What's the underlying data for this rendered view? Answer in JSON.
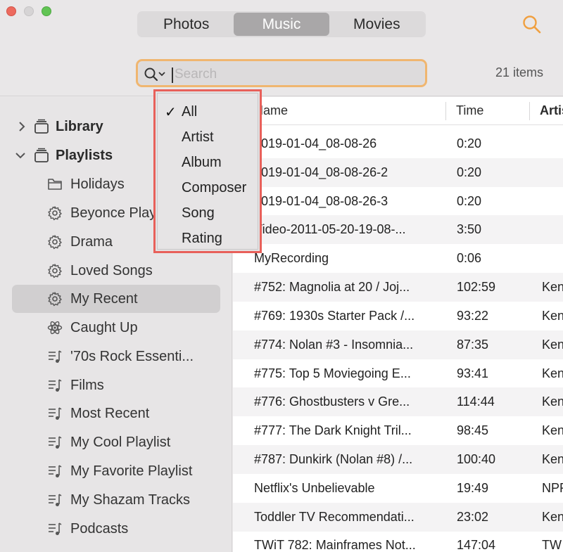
{
  "toolbar": {
    "tabs": [
      {
        "label": "Photos",
        "active": false
      },
      {
        "label": "Music",
        "active": true
      },
      {
        "label": "Movies",
        "active": false
      }
    ],
    "search": {
      "placeholder": "Search",
      "value": ""
    },
    "items_count": "21 items",
    "accent_color": "#f0b670"
  },
  "scope_menu": {
    "highlight_color": "#e8605a",
    "selected": "All",
    "items": [
      "All",
      "Artist",
      "Album",
      "Composer",
      "Song",
      "Rating"
    ]
  },
  "sidebar": {
    "library": {
      "label": "Library",
      "expanded": false
    },
    "playlists": {
      "label": "Playlists",
      "expanded": true
    },
    "items": [
      {
        "label": "Holidays",
        "icon": "folder-icon"
      },
      {
        "label": "Beyonce Playlist",
        "icon": "gear-icon"
      },
      {
        "label": "Drama",
        "icon": "gear-icon"
      },
      {
        "label": "Loved Songs",
        "icon": "gear-icon"
      },
      {
        "label": "My Recent",
        "icon": "gear-icon",
        "selected": true
      },
      {
        "label": "Caught Up",
        "icon": "atom-icon"
      },
      {
        "label": "'70s Rock Essenti...",
        "icon": "playlist-icon"
      },
      {
        "label": "Films",
        "icon": "playlist-icon"
      },
      {
        "label": "Most Recent",
        "icon": "playlist-icon"
      },
      {
        "label": "My Cool Playlist",
        "icon": "playlist-icon"
      },
      {
        "label": "My Favorite Playlist",
        "icon": "playlist-icon"
      },
      {
        "label": "My Shazam Tracks",
        "icon": "playlist-icon"
      },
      {
        "label": "Podcasts",
        "icon": "playlist-icon"
      }
    ]
  },
  "table": {
    "columns": [
      "Name",
      "Time",
      "Artist"
    ],
    "rows": [
      {
        "name": "2019-01-04_08-08-26",
        "time": "0:20",
        "artist": ""
      },
      {
        "name": "2019-01-04_08-08-26-2",
        "time": "0:20",
        "artist": ""
      },
      {
        "name": "2019-01-04_08-08-26-3",
        "time": "0:20",
        "artist": ""
      },
      {
        "name": "Video-2011-05-20-19-08-...",
        "time": "3:50",
        "artist": ""
      },
      {
        "name": "MyRecording",
        "time": "0:06",
        "artist": ""
      },
      {
        "name": "#752: Magnolia at 20 / Joj...",
        "time": "102:59",
        "artist": "Ken"
      },
      {
        "name": "#769: 1930s Starter Pack /...",
        "time": "93:22",
        "artist": "Ken"
      },
      {
        "name": "#774: Nolan #3 - Insomnia...",
        "time": "87:35",
        "artist": "Ken"
      },
      {
        "name": "#775: Top 5 Moviegoing E...",
        "time": "93:41",
        "artist": "Ken"
      },
      {
        "name": "#776: Ghostbusters v Gre...",
        "time": "114:44",
        "artist": "Ken"
      },
      {
        "name": "#777: The Dark Knight Tril...",
        "time": "98:45",
        "artist": "Ken"
      },
      {
        "name": "#787: Dunkirk (Nolan #8) /...",
        "time": "100:40",
        "artist": "Ken"
      },
      {
        "name": "Netflix's Unbelievable",
        "time": "19:49",
        "artist": "NPR"
      },
      {
        "name": "Toddler TV Recommendati...",
        "time": "23:02",
        "artist": "Ken"
      },
      {
        "name": "TWiT 782: Mainframes Not...",
        "time": "147:04",
        "artist": "TW"
      }
    ]
  }
}
